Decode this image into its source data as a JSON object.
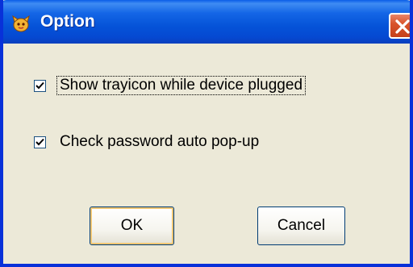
{
  "window": {
    "title": "Option",
    "title_icon": "app-mascot-icon",
    "close_icon": "close-icon"
  },
  "options": [
    {
      "label": "Show trayicon while device plugged",
      "checked": true
    },
    {
      "label": "Check password auto pop-up",
      "checked": true
    }
  ],
  "buttons": {
    "ok_label": "OK",
    "cancel_label": "Cancel"
  },
  "colors": {
    "titlebar": "#0553d8",
    "dialog_bg": "#ece9d8",
    "close_button": "#d9542c",
    "default_button_highlight": "#f0c673"
  }
}
